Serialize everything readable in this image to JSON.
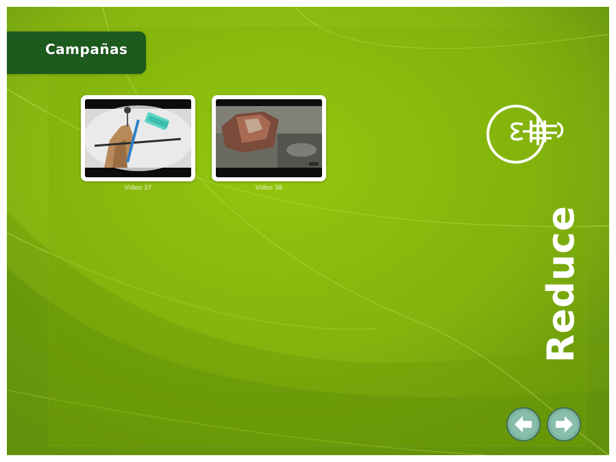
{
  "header": {
    "title": "Campañas"
  },
  "videos": [
    {
      "caption": "Video 37",
      "thumbnail": "nail-clip-still"
    },
    {
      "caption": "Video 38",
      "thumbnail": "crushed-can-still"
    }
  ],
  "side": {
    "word": "Reduce",
    "icon": "lightbulb-icon"
  },
  "nav": {
    "prev_icon": "arrow-left-icon",
    "next_icon": "arrow-right-icon"
  },
  "colors": {
    "background": "#86b511",
    "title_tab": "#1c5a1e",
    "nav_button": "#7fb5a0",
    "text": "#ffffff"
  }
}
